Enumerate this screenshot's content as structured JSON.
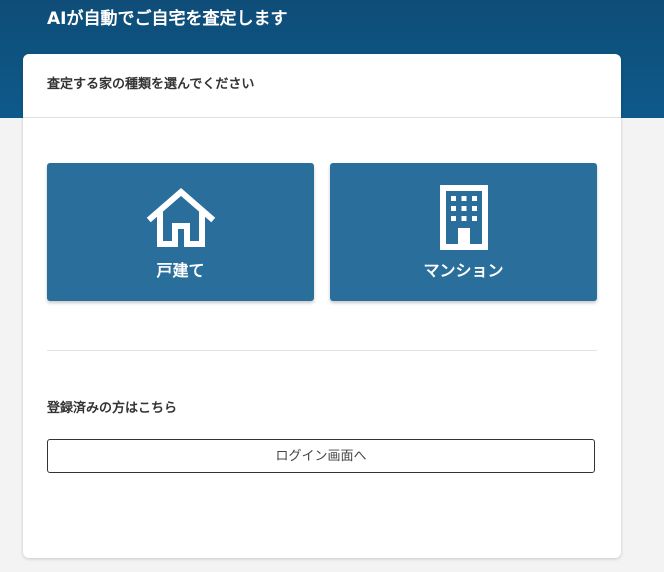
{
  "header": {
    "title": "AIが自動でご自宅を査定します"
  },
  "card": {
    "prompt": "査定する家の種類を選んでください",
    "options": [
      {
        "label": "戸建て",
        "icon": "house-icon"
      },
      {
        "label": "マンション",
        "icon": "building-icon"
      }
    ],
    "registered_label": "登録済みの方はこちら",
    "login_button_label": "ログイン画面へ"
  },
  "colors": {
    "header_bg": "#0f4d78",
    "option_bg": "#2a6f9b",
    "page_bg": "#f3f3f3"
  }
}
